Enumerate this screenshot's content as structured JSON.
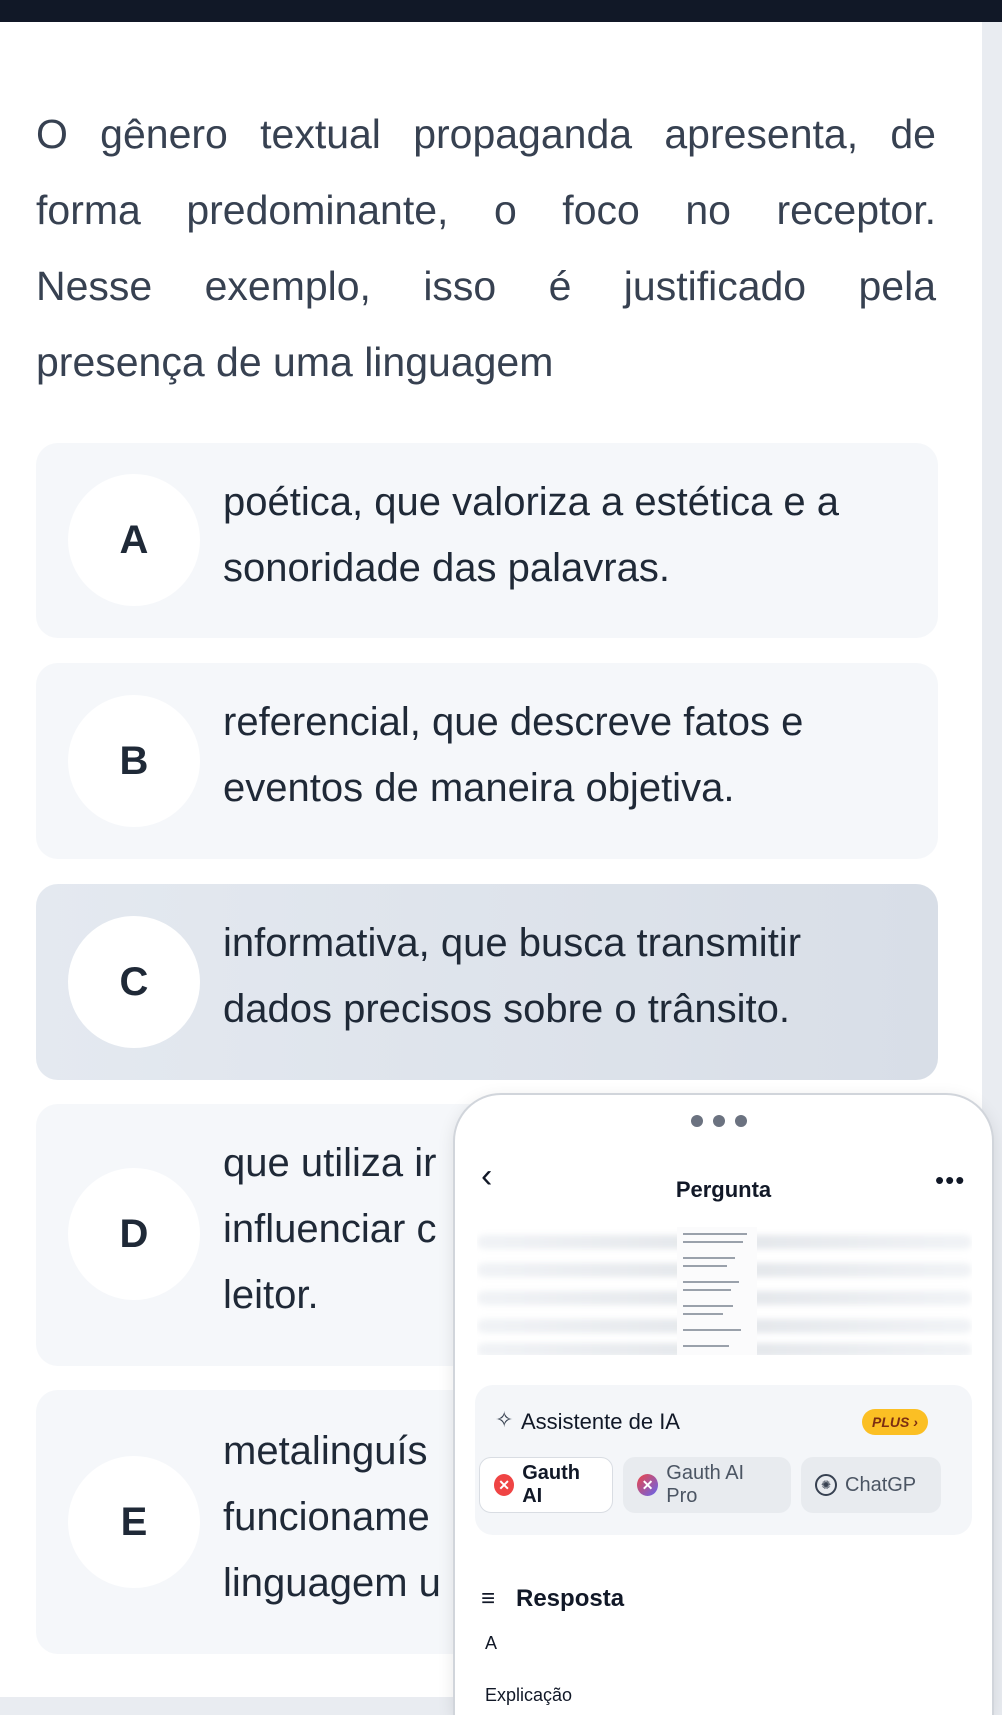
{
  "question": {
    "lines": [
      "O gênero textual propaganda apresenta, de",
      "forma predominante, o foco no receptor.",
      "Nesse exemplo, isso é justificado pela",
      "presença de uma linguagem"
    ]
  },
  "options": [
    {
      "letter": "A",
      "lines": [
        "poética, que valoriza a estética e a",
        "sonoridade das palavras."
      ]
    },
    {
      "letter": "B",
      "lines": [
        "referencial, que descreve fatos e",
        "eventos de maneira objetiva."
      ]
    },
    {
      "letter": "C",
      "lines": [
        "informativa, que busca transmitir",
        "dados precisos sobre o trânsito."
      ],
      "selected": true
    },
    {
      "letter": "D",
      "lines": [
        "que utiliza ir",
        "influenciar c",
        "leitor."
      ]
    },
    {
      "letter": "E",
      "lines": [
        "metalinguís",
        "funcioname",
        "linguagem u"
      ]
    }
  ],
  "overlay": {
    "back_icon": "chevron-left-icon",
    "title": "Pergunta",
    "more_icon": "more-horizontal-icon",
    "ai_section": {
      "icon": "sparkle-icon",
      "title": "Assistente de IA",
      "badge": "PLUS ›",
      "tabs": [
        {
          "label": "Gauth AI",
          "icon": "gauth-icon",
          "active": true
        },
        {
          "label": "Gauth AI Pro",
          "icon": "gauth-pro-icon",
          "active": false
        },
        {
          "label": "ChatGP",
          "icon": "chatgpt-icon",
          "active": false
        }
      ]
    },
    "answer": {
      "icon": "list-icon",
      "label": "Resposta",
      "value": "A"
    },
    "explanation_label": "Explicação"
  },
  "colors": {
    "selected_option_bg": "#dde3ea",
    "option_bg": "#f5f7fa",
    "badge_bg": "#fbbf24",
    "gauth_red": "#ef4444"
  }
}
